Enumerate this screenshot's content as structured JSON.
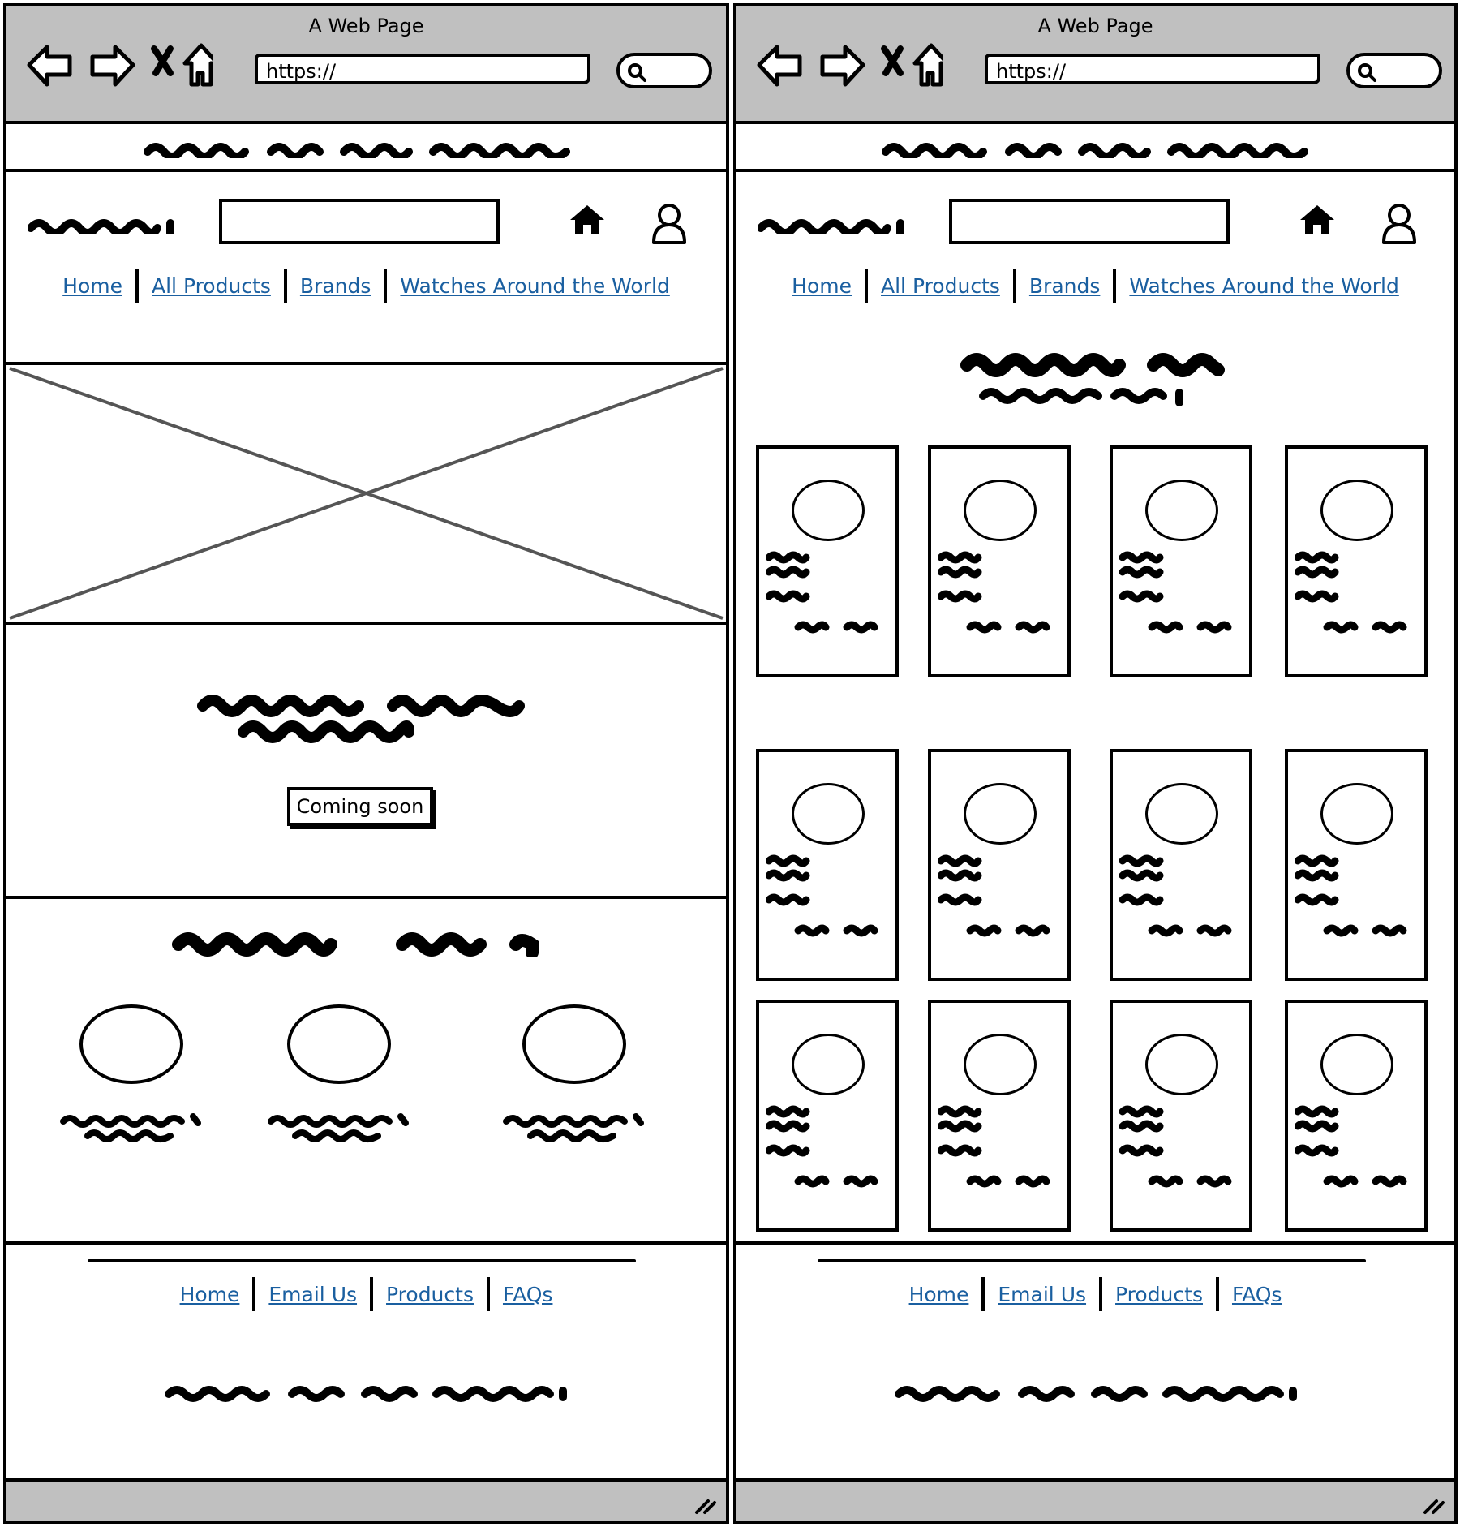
{
  "left_window": {
    "title": "A Web Page",
    "url_placeholder": "https://",
    "nav_links": [
      "Home",
      "All Products",
      "Brands",
      "Watches Around the World"
    ],
    "promo_button": "Coming soon",
    "footer_links": [
      "Home",
      "Email Us",
      "Products",
      "FAQs"
    ]
  },
  "right_window": {
    "title": "A Web Page",
    "url_placeholder": "https://",
    "nav_links": [
      "Home",
      "All Products",
      "Brands",
      "Watches Around the World"
    ],
    "footer_links": [
      "Home",
      "Email Us",
      "Products",
      "FAQs"
    ]
  },
  "icons": {
    "back": "arrow-left-icon",
    "forward": "arrow-right-icon",
    "stop": "close-icon",
    "home_browser": "home-outline-icon",
    "search": "search-icon",
    "home": "home-icon",
    "account": "user-icon",
    "resize": "resize-grip-icon",
    "hero_image": "image-placeholder-icon"
  },
  "colors": {
    "chrome": "#c0c0c0",
    "link": "#1a5fa0",
    "ink": "#000000"
  }
}
